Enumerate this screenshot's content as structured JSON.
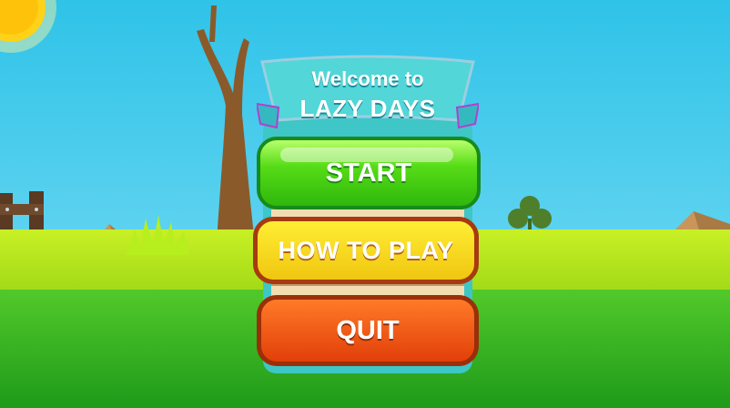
{
  "title": {
    "line1": "Welcome to",
    "line2": "LAZY DAYS"
  },
  "menu": {
    "start_label": "START",
    "how_to_play_label": "HOW TO PLAY",
    "quit_label": "QUIT"
  },
  "colors": {
    "sky": "#2fc3e8",
    "grass": "#52c92a",
    "start_button": "#56dc16",
    "how_to_play_button": "#f0c610",
    "quit_button": "#e23f09",
    "title_banner": "#52d6d8"
  },
  "icons": [
    "sun-icon",
    "tree-icon",
    "fence-icon",
    "clover-icon",
    "rock-icon",
    "grass-tuft-icon"
  ]
}
